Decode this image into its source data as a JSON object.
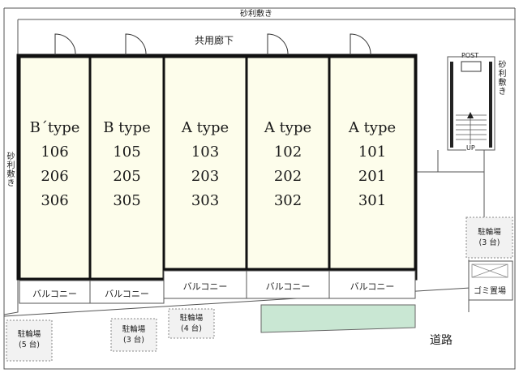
{
  "top_label": "砂利敷き",
  "corridor_label": "共用廊下",
  "left_label": "砂利敷き",
  "right_label": "砂利敷き",
  "post_label": "POST",
  "up_label": "UP",
  "road_label": "道路",
  "garbage_label": "ゴミ置場",
  "units": [
    {
      "type": "B´type",
      "rooms": [
        "106",
        "206",
        "306"
      ]
    },
    {
      "type": "B type",
      "rooms": [
        "105",
        "205",
        "305"
      ]
    },
    {
      "type": "A type",
      "rooms": [
        "103",
        "203",
        "303"
      ]
    },
    {
      "type": "A type",
      "rooms": [
        "102",
        "202",
        "302"
      ]
    },
    {
      "type": "A type",
      "rooms": [
        "101",
        "201",
        "301"
      ]
    }
  ],
  "balconies": [
    "バルコニー",
    "バルコニー",
    "バルコニー",
    "バルコニー",
    "バルコニー"
  ],
  "bike_parking": [
    {
      "label": "駐輪場",
      "count": "(5 台)"
    },
    {
      "label": "駐輪場",
      "count": "(3 台)"
    },
    {
      "label": "駐輪場",
      "count": "(4 台)"
    },
    {
      "label": "駐輪場",
      "count": "(3 台)"
    }
  ],
  "colors": {
    "unit_fill": "#fdfdeb",
    "green_area": "#c9e7d3",
    "bike_fill": "#f2f2f2"
  }
}
